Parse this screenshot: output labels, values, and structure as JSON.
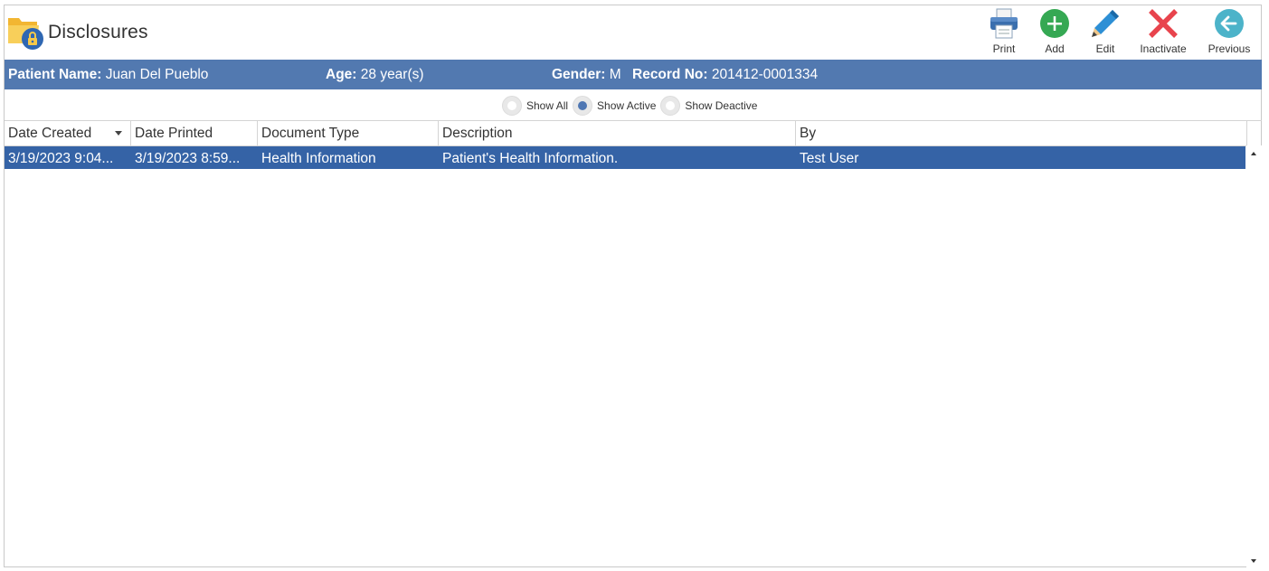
{
  "header": {
    "title": "Disclosures",
    "title_icon": "folder-lock-icon"
  },
  "toolbar": {
    "print": {
      "label": "Print",
      "icon": "printer-icon"
    },
    "add": {
      "label": "Add",
      "icon": "plus-circle-icon",
      "color": "#35a853"
    },
    "edit": {
      "label": "Edit",
      "icon": "pencil-icon",
      "color": "#2d8fd5"
    },
    "inactivate": {
      "label": "Inactivate",
      "icon": "red-x-icon",
      "color": "#e8444d"
    },
    "previous": {
      "label": "Previous",
      "icon": "arrow-left-circle-icon",
      "color": "#4cb3c9"
    }
  },
  "patient": {
    "name_label": "Patient Name:",
    "name": "Juan Del Pueblo",
    "age_label": "Age:",
    "age": "28 year(s)",
    "gender_label": "Gender:",
    "gender": "M",
    "record_label": "Record No:",
    "record": "201412-0001334",
    "bar_color": "#5279b0"
  },
  "filters": [
    {
      "label": "Show All",
      "checked": false
    },
    {
      "label": "Show Active",
      "checked": true
    },
    {
      "label": "Show Deactive",
      "checked": false
    }
  ],
  "grid": {
    "columns": [
      "Date Created",
      "Date Printed",
      "Document Type",
      "Description",
      "By"
    ],
    "sorted_column": "Date Created",
    "rows": [
      {
        "date_created": "3/19/2023 9:04...",
        "date_printed": "3/19/2023 8:59...",
        "document_type": "Health Information",
        "description": "Patient's Health Information.",
        "by": "Test User",
        "selected": true
      }
    ],
    "selection_color": "#3563a6"
  }
}
